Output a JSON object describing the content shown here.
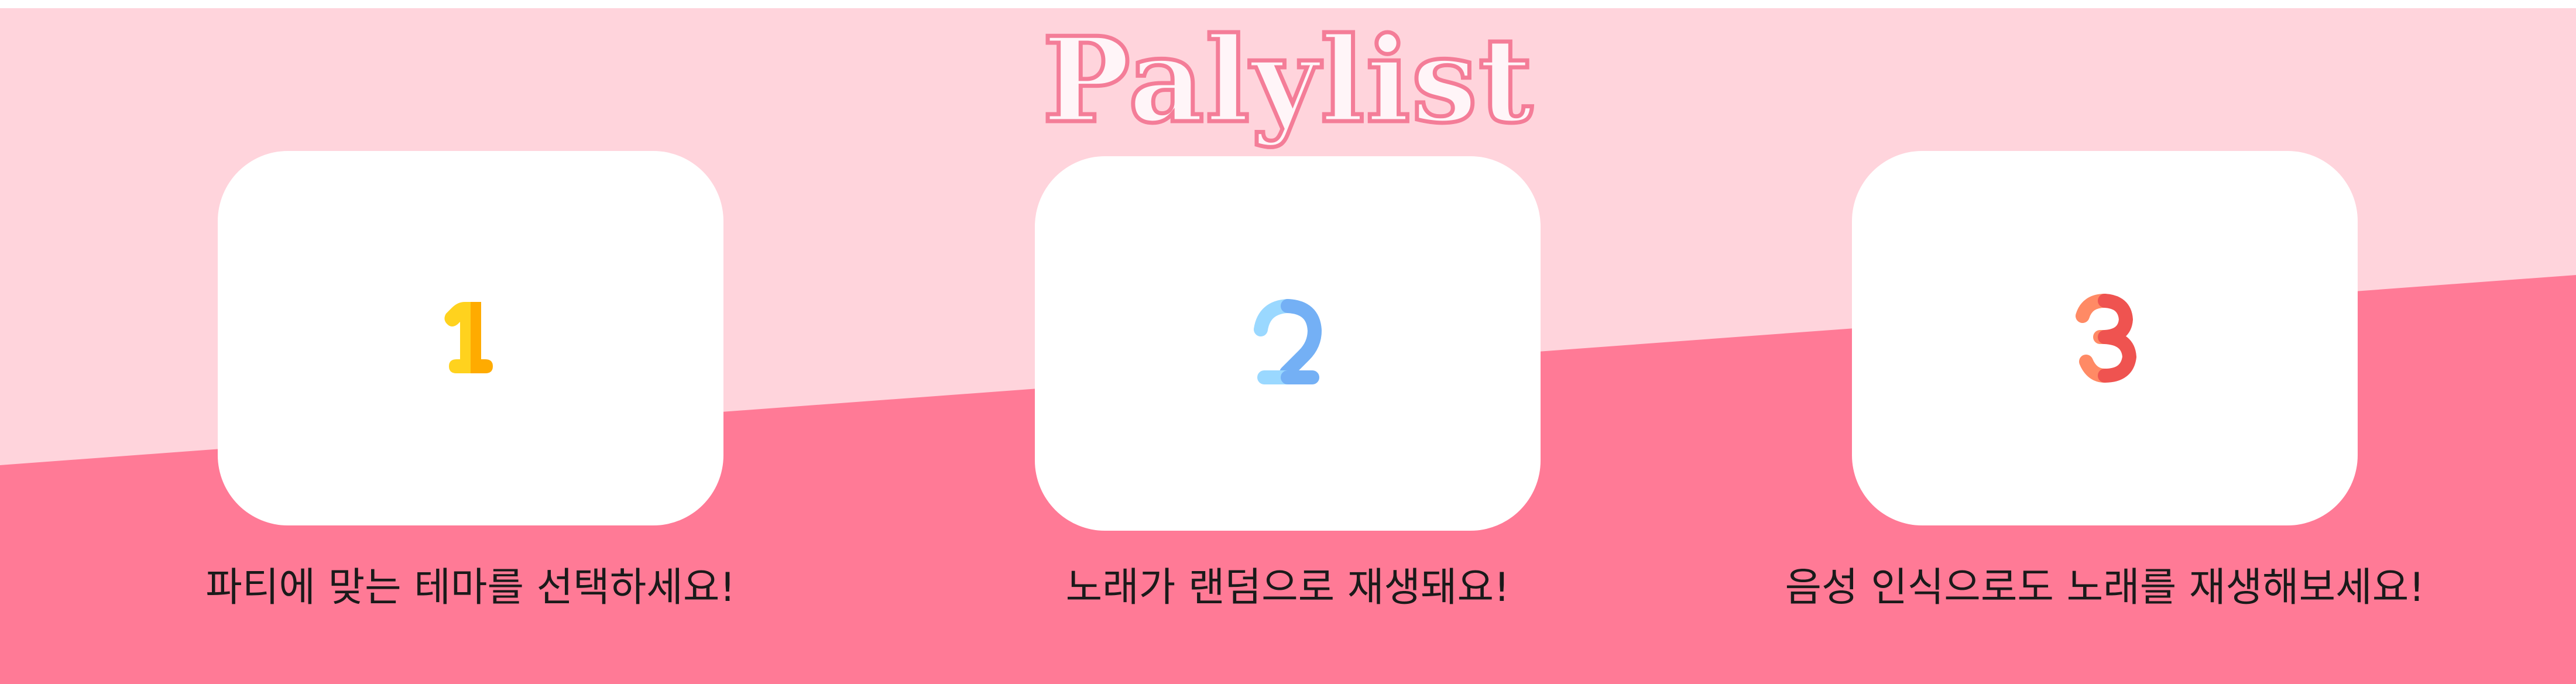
{
  "title": "Palylist",
  "colors": {
    "background_light": "#ffd4dc",
    "background_dark": "#ff7a96",
    "title_outline": "#f47d98",
    "card": "#ffffff"
  },
  "steps": [
    {
      "number": "1",
      "icon": "number-one-icon",
      "icon_colors": [
        "#ffd21e",
        "#ffab00"
      ],
      "caption": "파티에 맞는 테마를 선택하세요!"
    },
    {
      "number": "2",
      "icon": "number-two-icon",
      "icon_colors": [
        "#9ad8ff",
        "#74b0f5"
      ],
      "caption": "노래가 랜덤으로 재생돼요!"
    },
    {
      "number": "3",
      "icon": "number-three-icon",
      "icon_colors": [
        "#ff8a65",
        "#ef5350"
      ],
      "caption": "음성 인식으로도 노래를 재생해보세요!"
    }
  ]
}
